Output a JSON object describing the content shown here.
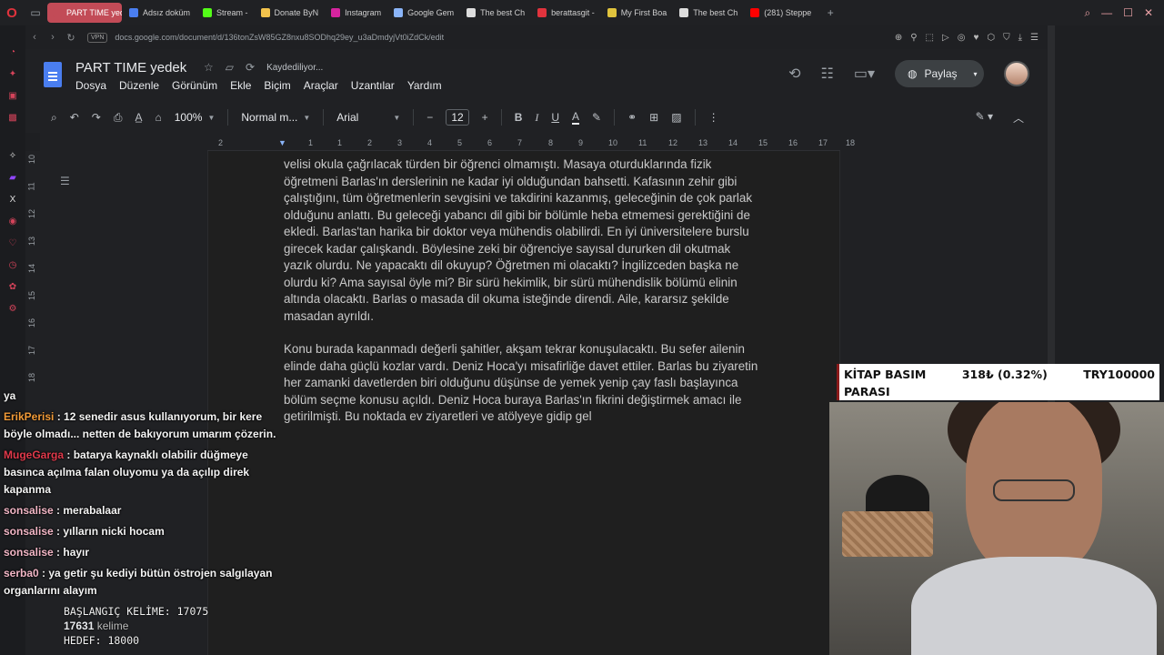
{
  "browser": {
    "tabs": [
      {
        "label": "PART TIME yedek - Goo",
        "active": true,
        "color": "#c24b57"
      },
      {
        "label": "Adsız doküm",
        "color": "#4a7ef0"
      },
      {
        "label": "Stream -",
        "color": "#53fc18"
      },
      {
        "label": "Donate ByN",
        "color": "#f3c34c"
      },
      {
        "label": "Instagram",
        "color": "#d6249f"
      },
      {
        "label": "Google Gem",
        "color": "#8ab4f8"
      },
      {
        "label": "The best Ch",
        "color": "#dddddd"
      },
      {
        "label": "berattasgit -",
        "color": "#e0333d"
      },
      {
        "label": "My First Boa",
        "color": "#e0c33d"
      },
      {
        "label": "The best Ch",
        "color": "#dddddd"
      },
      {
        "label": "(281) Steppe",
        "color": "#ff0000"
      }
    ],
    "new_tab": "+",
    "url": "docs.google.com/document/d/136tonZsW85GZ8nxu8SODhq29ey_u3aDmdyjVt0iZdCk/edit",
    "vpn_label": "VPN"
  },
  "docs": {
    "title": "PART TIME  yedek",
    "saving_status": "Kaydediliyor...",
    "menus": [
      "Dosya",
      "Düzenle",
      "Görünüm",
      "Ekle",
      "Biçim",
      "Araçlar",
      "Uzantılar",
      "Yardım"
    ],
    "share_label": "Paylaş",
    "zoom": "100%",
    "style": "Normal m...",
    "font": "Arial",
    "font_size": "12",
    "ruler_ticks": [
      "2",
      "1",
      "1",
      "2",
      "3",
      "4",
      "5",
      "6",
      "7",
      "8",
      "9",
      "10",
      "11",
      "12",
      "13",
      "14",
      "15",
      "16",
      "17",
      "18"
    ],
    "vruler_ticks": [
      "10",
      "11",
      "12",
      "13",
      "14",
      "15",
      "16",
      "17",
      "18"
    ],
    "paragraphs": [
      "velisi okula çağrılacak türden bir öğrenci olmamıştı. Masaya oturduklarında fizik öğretmeni Barlas'ın derslerinin ne kadar iyi olduğundan bahsetti. Kafasının zehir gibi çalıştığını, tüm öğretmenlerin sevgisini ve takdirini kazanmış, geleceğinin de çok parlak olduğunu anlattı. Bu geleceği yabancı dil gibi bir bölümle heba etmemesi gerektiğini de ekledi. Barlas'tan harika bir doktor veya mühendis olabilirdi. En iyi üniversitelere burslu girecek kadar çalışkandı. Böylesine zeki bir öğrenciye sayısal dururken dil okutmak yazık olurdu. Ne yapacaktı dil okuyup? Öğretmen mi olacaktı? İngilizceden başka ne olurdu ki? Ama sayısal öyle mi? Bir sürü hekimlik, bir sürü mühendislik bölümü elinin altında olacaktı. Barlas o masada dil okuma isteğinde direndi. Aile, kararsız şekilde masadan ayrıldı.",
      "Konu burada kapanmadı değerli şahitler, akşam tekrar konuşulacaktı. Bu sefer ailenin elinde daha güçlü kozlar vardı. Deniz Hoca'yı misafirliğe davet ettiler. Barlas bu ziyaretin her zamanki davetlerden biri olduğunu düşünse de yemek yenip çay faslı başlayınca bölüm seçme konusu açıldı. Deniz Hoca buraya Barlas'ın fikrini değiştirmek amacı ile getirilmişti. Bu noktada ev ziyaretleri ve atölyeye gidip gel"
    ]
  },
  "ticker": {
    "name_line1": "KİTAP BASIM",
    "name_line2": "PARASI",
    "price": "318₺ (0.32%)",
    "target": "TRY100000"
  },
  "chat": [
    {
      "user": "",
      "text": "ya",
      "color": "#f4f4f4"
    },
    {
      "user": "ErikPerisi",
      "text": ": 12 senedir asus kullanıyorum, bir kere böyle olmadı... netten de bakıyorum umarım çözerin.",
      "color": "#f29b38"
    },
    {
      "user": "MugeGarga",
      "text": ": batarya kaynaklı olabilir düğmeye basınca açılma falan oluyomu ya da açılıp direk kapanma",
      "color": "#e0394b"
    },
    {
      "user": "sonsalise",
      "text": ": merabalaar",
      "color": "#f2b6c6"
    },
    {
      "user": "sonsalise",
      "text": ": yılların nicki hocam",
      "color": "#f2b6c6"
    },
    {
      "user": "sonsalise",
      "text": ": hayır",
      "color": "#f2b6c6"
    },
    {
      "user": "serba0",
      "text": ": ya getir şu kediyi bütün östrojen salgılayan organlarını alayım",
      "color": "#f2b6c6"
    }
  ],
  "counter": {
    "start": "BAŞLANGIÇ KELİME: 17075",
    "current_value": "17631",
    "current_unit": "kelime",
    "goal": "HEDEF: 18000"
  }
}
